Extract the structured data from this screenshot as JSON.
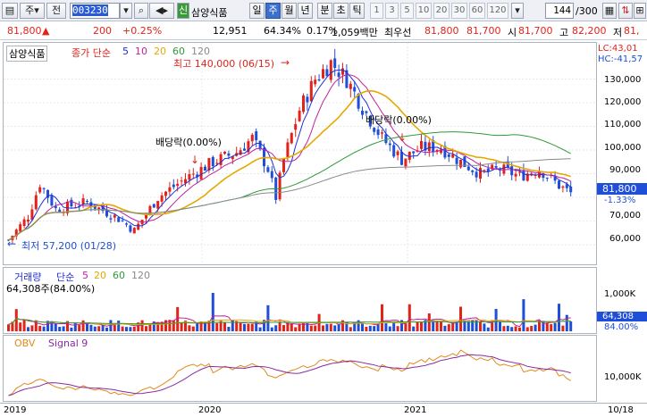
{
  "toolbar": {
    "period_select": "주",
    "type_btn": "전",
    "code_value": "003230",
    "tag": "신",
    "stock_name": "삼양식품",
    "tabs": [
      "일",
      "주",
      "월",
      "년",
      "분",
      "초",
      "틱"
    ],
    "selected_tab": "주",
    "interval_nums": [
      "1",
      "3",
      "5",
      "10",
      "20",
      "30",
      "60",
      "120"
    ],
    "count": "144",
    "total": "/300",
    "icons": [
      "calculator-icon",
      "rise-fall-icon",
      "grid-icon",
      "close-icon",
      "lock-icon"
    ]
  },
  "quote": {
    "price": "81,800",
    "arrow": "▲",
    "change": "200",
    "change_pct": "+0.25%",
    "volume": "12,951",
    "vol_rate": "64.34%",
    "turnover": "0.17%",
    "amount": "1,059백만",
    "best_label": "최우선",
    "ask": "81,800",
    "bid": "81,700",
    "open_label": "시",
    "open": "81,700",
    "high_label": "고",
    "high": "82,200",
    "low_label": "저",
    "low": "81,"
  },
  "price_panel": {
    "title": "삼양식품",
    "ma_label": "종가 단순",
    "ma_periods": [
      "5",
      "10",
      "20",
      "60",
      "120"
    ],
    "lc": "LC:43,01",
    "hc": "HC:-41,57",
    "high_note": "최고 140,000 (06/15)",
    "low_note": "최저 57,200 (01/28)",
    "div_note1": "배당락(0.00%)",
    "div_note2": "배당락(0.00%)",
    "current_price": "81,800",
    "current_pct": "-1.33%",
    "y_ticks": [
      "130,000",
      "120,000",
      "110,000",
      "100,000",
      "90,000",
      "80,000",
      "70,000",
      "60,000"
    ]
  },
  "volume_panel": {
    "title": "거래량",
    "ma_label": "단순",
    "ma_periods": [
      "5",
      "20",
      "60",
      "120"
    ],
    "value_note": "64,308주(84.00%)",
    "y_ticks": [
      "1,000K",
      "500K"
    ],
    "current_vol": "64,308",
    "current_pct": "84.00%"
  },
  "obv_panel": {
    "title": "OBV",
    "signal": "Signal 9",
    "y_tick": "10,000K"
  },
  "x_axis": {
    "labels": [
      "2019",
      "2020",
      "2021",
      "10/18"
    ]
  },
  "colors": {
    "up": "#e2231a",
    "down": "#1f4fd8",
    "ma5": "#1f2fd8",
    "ma10": "#c0209a",
    "ma20": "#e5a800",
    "ma60": "#2e9a3a",
    "ma120": "#8a8a8a"
  },
  "chart_data": {
    "type": "candlestick",
    "n_bars": 144,
    "price_range": [
      54000,
      143000
    ],
    "high": 140000,
    "low": 57200,
    "last_close": 81800,
    "volume_max_k": 1250
  }
}
